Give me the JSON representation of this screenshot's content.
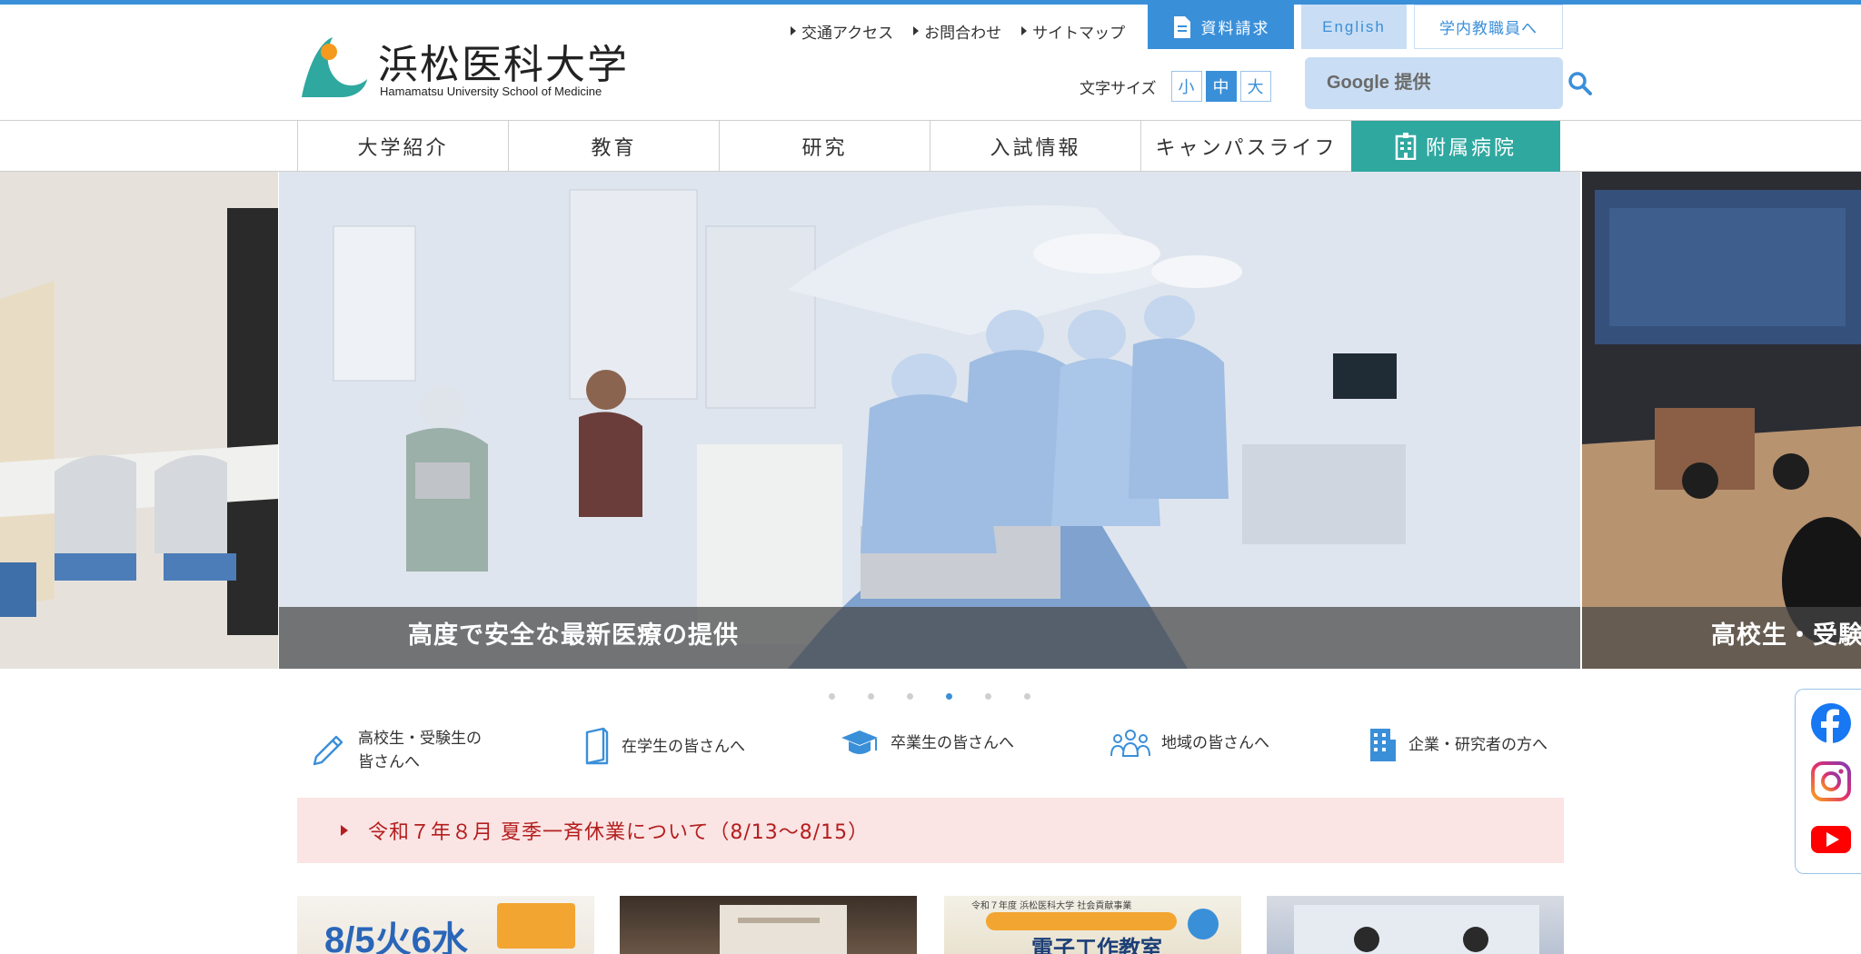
{
  "header": {
    "logo_jp": "浜松医科大学",
    "logo_en": "Hamamatsu University School of Medicine",
    "util_links": [
      "交通アクセス",
      "お問合わせ",
      "サイトマップ"
    ],
    "shiryo_label": "資料請求",
    "english_label": "English",
    "staff_label": "学内教職員へ",
    "fontsize_label": "文字サイズ",
    "fontsize_options": [
      "小",
      "中",
      "大"
    ],
    "fontsize_selected": "中",
    "search_placeholder": "Google 提供",
    "accent_color": "#3a8fd9"
  },
  "nav": {
    "items": [
      "大学紹介",
      "教育",
      "研究",
      "入試情報",
      "キャンパスライフ"
    ],
    "hospital_label": "附属病院",
    "hospital_color": "#2fa8a0"
  },
  "hero": {
    "main_caption": "高度で安全な最新医療の提供",
    "next_caption": "高校生・受験",
    "dot_count": 6,
    "active_dot": 4
  },
  "audience": [
    {
      "icon": "pencil-icon",
      "label_line1": "高校生・受験生の",
      "label_line2": "皆さんへ"
    },
    {
      "icon": "book-icon",
      "label_line1": "在学生の皆さんへ",
      "label_line2": ""
    },
    {
      "icon": "graduation-cap-icon",
      "label_line1": "卒業生の皆さんへ",
      "label_line2": ""
    },
    {
      "icon": "people-icon",
      "label_line1": "地域の皆さんへ",
      "label_line2": ""
    },
    {
      "icon": "building-icon",
      "label_line1": "企業・研究者の方へ",
      "label_line2": ""
    }
  ],
  "notice": {
    "text": "令和７年８月 夏季一斉休業について（8/13〜8/15）",
    "color": "#b41e1e"
  },
  "cards": {
    "card1_text": "8/5火6水",
    "card3_head": "令和７年度 浜松医科大学 社会貢献事業",
    "card3_title": "電子工作教室"
  },
  "social": [
    "facebook-icon",
    "instagram-icon",
    "youtube-icon"
  ]
}
